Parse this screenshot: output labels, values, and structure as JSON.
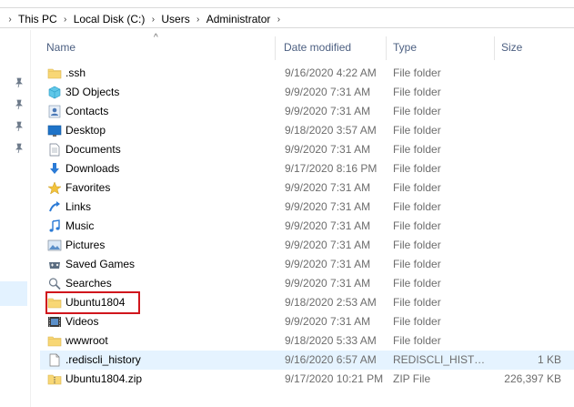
{
  "breadcrumb": {
    "items": [
      "This PC",
      "Local Disk (C:)",
      "Users",
      "Administrator"
    ]
  },
  "columns": {
    "name": "Name",
    "date_modified": "Date modified",
    "type": "Type",
    "size": "Size"
  },
  "files": [
    {
      "name": ".ssh",
      "date": "9/16/2020 4:22 AM",
      "type": "File folder",
      "size": "",
      "icon": "folder-icon"
    },
    {
      "name": "3D Objects",
      "date": "9/9/2020 7:31 AM",
      "type": "File folder",
      "size": "",
      "icon": "3d-objects-icon"
    },
    {
      "name": "Contacts",
      "date": "9/9/2020 7:31 AM",
      "type": "File folder",
      "size": "",
      "icon": "contacts-icon"
    },
    {
      "name": "Desktop",
      "date": "9/18/2020 3:57 AM",
      "type": "File folder",
      "size": "",
      "icon": "desktop-icon"
    },
    {
      "name": "Documents",
      "date": "9/9/2020 7:31 AM",
      "type": "File folder",
      "size": "",
      "icon": "documents-icon"
    },
    {
      "name": "Downloads",
      "date": "9/17/2020 8:16 PM",
      "type": "File folder",
      "size": "",
      "icon": "downloads-icon"
    },
    {
      "name": "Favorites",
      "date": "9/9/2020 7:31 AM",
      "type": "File folder",
      "size": "",
      "icon": "favorites-icon"
    },
    {
      "name": "Links",
      "date": "9/9/2020 7:31 AM",
      "type": "File folder",
      "size": "",
      "icon": "links-icon"
    },
    {
      "name": "Music",
      "date": "9/9/2020 7:31 AM",
      "type": "File folder",
      "size": "",
      "icon": "music-icon"
    },
    {
      "name": "Pictures",
      "date": "9/9/2020 7:31 AM",
      "type": "File folder",
      "size": "",
      "icon": "pictures-icon"
    },
    {
      "name": "Saved Games",
      "date": "9/9/2020 7:31 AM",
      "type": "File folder",
      "size": "",
      "icon": "saved-games-icon"
    },
    {
      "name": "Searches",
      "date": "9/9/2020 7:31 AM",
      "type": "File folder",
      "size": "",
      "icon": "searches-icon"
    },
    {
      "name": "Ubuntu1804",
      "date": "9/18/2020 2:53 AM",
      "type": "File folder",
      "size": "",
      "icon": "folder-icon"
    },
    {
      "name": "Videos",
      "date": "9/9/2020 7:31 AM",
      "type": "File folder",
      "size": "",
      "icon": "videos-icon"
    },
    {
      "name": "wwwroot",
      "date": "9/18/2020 5:33 AM",
      "type": "File folder",
      "size": "",
      "icon": "folder-icon"
    },
    {
      "name": ".rediscli_history",
      "date": "9/16/2020 6:57 AM",
      "type": "REDISCLI_HISTOR...",
      "size": "1 KB",
      "icon": "file-icon"
    },
    {
      "name": "Ubuntu1804.zip",
      "date": "9/17/2020 10:21 PM",
      "type": "ZIP File",
      "size": "226,397 KB",
      "icon": "zip-icon"
    }
  ],
  "colors": {
    "highlight_border": "#d0161c",
    "selected_row": "#e5f3ff",
    "folder_yellow": "#f8d775",
    "header_text": "#4d6082"
  }
}
